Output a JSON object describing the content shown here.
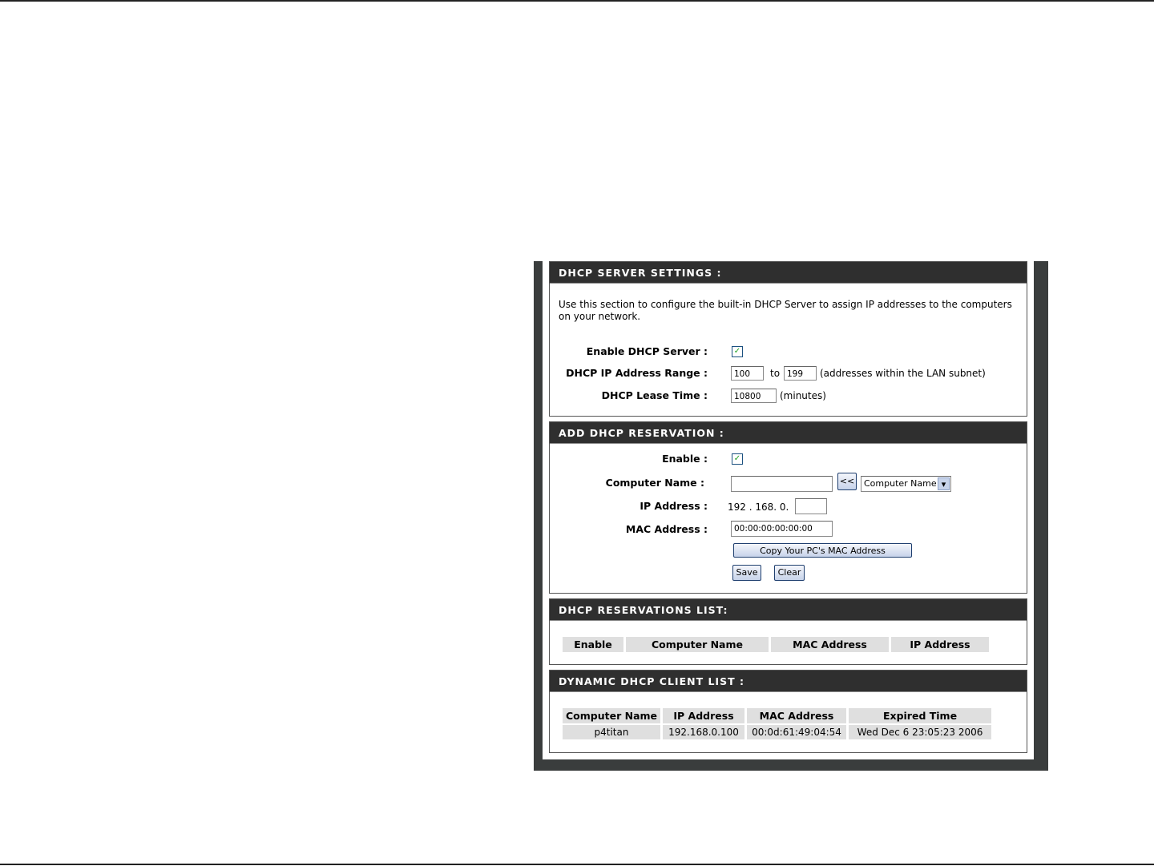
{
  "dhcp_server": {
    "title": "DHCP SERVER SETTINGS :",
    "description": "Use this section to configure the built-in DHCP Server to assign IP addresses to the computers on your network.",
    "enable_label": "Enable DHCP Server :",
    "enable_checked": true,
    "check_mark": "✓",
    "range_label": "DHCP IP Address Range :",
    "range_start": "100",
    "range_to": "to",
    "range_end": "199",
    "range_note": "(addresses within the LAN subnet)",
    "lease_label": "DHCP Lease Time :",
    "lease_value": "10800",
    "lease_unit": "(minutes)"
  },
  "reservation": {
    "title": "ADD DHCP RESERVATION :",
    "enable_label": "Enable :",
    "enable_checked": true,
    "check_mark": "✓",
    "computer_name_label": "Computer Name :",
    "computer_name_value": "",
    "copy_button": "<<",
    "computer_select": "Computer Name",
    "select_arrow": "▾",
    "ip_label": "IP Address :",
    "ip_prefix": "192 . 168. 0.",
    "ip_last": "",
    "mac_label": "MAC Address :",
    "mac_value": "00:00:00:00:00:00",
    "copy_mac_button": "Copy Your PC's MAC Address",
    "save_button": "Save",
    "clear_button": "Clear"
  },
  "reservations_list": {
    "title": "DHCP RESERVATIONS LIST:",
    "columns": [
      "Enable",
      "Computer Name",
      "MAC Address",
      "IP Address"
    ]
  },
  "client_list": {
    "title": "DYNAMIC DHCP CLIENT LIST :",
    "columns": [
      "Computer Name",
      "IP Address",
      "MAC Address",
      "Expired Time"
    ],
    "rows": [
      [
        "p4titan",
        "192.168.0.100",
        "00:0d:61:49:04:54",
        "Wed Dec 6 23:05:23 2006"
      ]
    ]
  }
}
